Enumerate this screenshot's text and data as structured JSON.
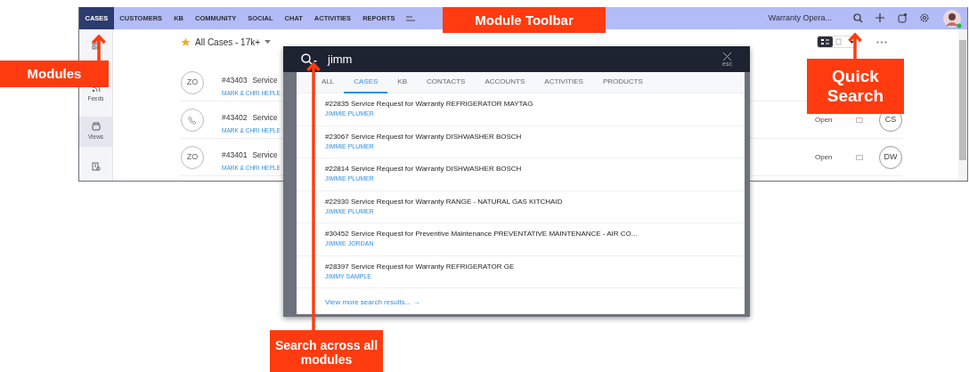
{
  "app": {
    "navbar": {
      "modules": [
        {
          "label": "CASES",
          "selected": true
        },
        {
          "label": "CUSTOMERS",
          "selected": false
        },
        {
          "label": "KB",
          "selected": false
        },
        {
          "label": "COMMUNITY",
          "selected": false
        },
        {
          "label": "SOCIAL",
          "selected": false
        },
        {
          "label": "CHAT",
          "selected": false
        },
        {
          "label": "ACTIVITIES",
          "selected": false
        },
        {
          "label": "REPORTS",
          "selected": false
        }
      ],
      "organization": "Warranty Opera..."
    },
    "sidebar": {
      "items": [
        {
          "kind": "grid",
          "selected": false
        },
        {
          "kind": "feeds",
          "label": "Feeds",
          "selected": false
        },
        {
          "kind": "views",
          "label": "Views",
          "selected": true
        },
        {
          "kind": "asset",
          "selected": false
        }
      ]
    },
    "view": {
      "title": "All Cases - 17k+"
    },
    "cases": [
      {
        "kind": "initials",
        "avatar": "ZO",
        "number": "#43403",
        "subject": "Service",
        "contact": "MARK & CHRI HEPLE"
      },
      {
        "kind": "phone",
        "number": "#43402",
        "subject": "Service",
        "contact": "MARK & CHRI HEPLE",
        "status": "Open",
        "owner": "CS"
      },
      {
        "kind": "initials",
        "avatar": "ZO",
        "number": "#43401",
        "subject": "Service",
        "contact": "MARK & CHRI HEPLE",
        "status": "Open",
        "owner": "DW"
      }
    ]
  },
  "search": {
    "query": "jimm",
    "close_hint": "esc",
    "tabs": [
      {
        "label": "ALL",
        "selected": false
      },
      {
        "label": "CASES",
        "selected": true
      },
      {
        "label": "KB",
        "selected": false
      },
      {
        "label": "CONTACTS",
        "selected": false
      },
      {
        "label": "ACCOUNTS",
        "selected": false
      },
      {
        "label": "ACTIVITIES",
        "selected": false
      },
      {
        "label": "PRODUCTS",
        "selected": false
      }
    ],
    "results": [
      {
        "title": "#22835 Service Request for Warranty REFRIGERATOR MAYTAG",
        "contact": "JIMMIE PLUMER"
      },
      {
        "title": "#23067 Service Request for Warranty DISHWASHER BOSCH",
        "contact": "JIMMIE PLUMER"
      },
      {
        "title": "#22814 Service Request for Warranty DISHWASHER BOSCH",
        "contact": "JIMMIE PLUMER"
      },
      {
        "title": "#22930 Service Request for Warranty RANGE - NATURAL GAS KITCHAID",
        "contact": "JIMMIE PLUMER"
      },
      {
        "title": "#30452 Service Request for Preventive Maintenance PREVENTATIVE MAINTENANCE - AIR CO...",
        "contact": "JIMMIE JORDAN"
      },
      {
        "title": "#28397 Service Request for Warranty REFRIGERATOR GE",
        "contact": "JIMMY SAMPLE"
      }
    ],
    "more_link": "View more search results... →"
  },
  "annotations": [
    {
      "kind": "modules",
      "text": "Modules"
    },
    {
      "kind": "toolbar",
      "text": "Module Toolbar"
    },
    {
      "kind": "quick",
      "text": "Quick Search"
    },
    {
      "kind": "across",
      "text": "Search across all modules"
    }
  ]
}
